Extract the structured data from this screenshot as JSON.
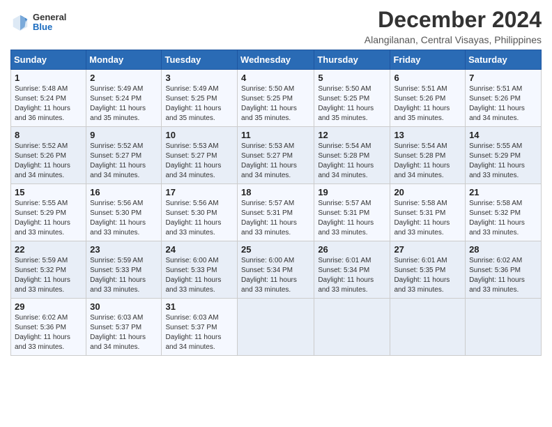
{
  "logo": {
    "general": "General",
    "blue": "Blue"
  },
  "title": "December 2024",
  "subtitle": "Alangilanan, Central Visayas, Philippines",
  "days_of_week": [
    "Sunday",
    "Monday",
    "Tuesday",
    "Wednesday",
    "Thursday",
    "Friday",
    "Saturday"
  ],
  "weeks": [
    [
      {
        "day": "1",
        "sunrise": "5:48 AM",
        "sunset": "5:24 PM",
        "daylight": "11 hours and 36 minutes."
      },
      {
        "day": "2",
        "sunrise": "5:49 AM",
        "sunset": "5:24 PM",
        "daylight": "11 hours and 35 minutes."
      },
      {
        "day": "3",
        "sunrise": "5:49 AM",
        "sunset": "5:25 PM",
        "daylight": "11 hours and 35 minutes."
      },
      {
        "day": "4",
        "sunrise": "5:50 AM",
        "sunset": "5:25 PM",
        "daylight": "11 hours and 35 minutes."
      },
      {
        "day": "5",
        "sunrise": "5:50 AM",
        "sunset": "5:25 PM",
        "daylight": "11 hours and 35 minutes."
      },
      {
        "day": "6",
        "sunrise": "5:51 AM",
        "sunset": "5:26 PM",
        "daylight": "11 hours and 35 minutes."
      },
      {
        "day": "7",
        "sunrise": "5:51 AM",
        "sunset": "5:26 PM",
        "daylight": "11 hours and 34 minutes."
      }
    ],
    [
      {
        "day": "8",
        "sunrise": "5:52 AM",
        "sunset": "5:26 PM",
        "daylight": "11 hours and 34 minutes."
      },
      {
        "day": "9",
        "sunrise": "5:52 AM",
        "sunset": "5:27 PM",
        "daylight": "11 hours and 34 minutes."
      },
      {
        "day": "10",
        "sunrise": "5:53 AM",
        "sunset": "5:27 PM",
        "daylight": "11 hours and 34 minutes."
      },
      {
        "day": "11",
        "sunrise": "5:53 AM",
        "sunset": "5:27 PM",
        "daylight": "11 hours and 34 minutes."
      },
      {
        "day": "12",
        "sunrise": "5:54 AM",
        "sunset": "5:28 PM",
        "daylight": "11 hours and 34 minutes."
      },
      {
        "day": "13",
        "sunrise": "5:54 AM",
        "sunset": "5:28 PM",
        "daylight": "11 hours and 34 minutes."
      },
      {
        "day": "14",
        "sunrise": "5:55 AM",
        "sunset": "5:29 PM",
        "daylight": "11 hours and 33 minutes."
      }
    ],
    [
      {
        "day": "15",
        "sunrise": "5:55 AM",
        "sunset": "5:29 PM",
        "daylight": "11 hours and 33 minutes."
      },
      {
        "day": "16",
        "sunrise": "5:56 AM",
        "sunset": "5:30 PM",
        "daylight": "11 hours and 33 minutes."
      },
      {
        "day": "17",
        "sunrise": "5:56 AM",
        "sunset": "5:30 PM",
        "daylight": "11 hours and 33 minutes."
      },
      {
        "day": "18",
        "sunrise": "5:57 AM",
        "sunset": "5:31 PM",
        "daylight": "11 hours and 33 minutes."
      },
      {
        "day": "19",
        "sunrise": "5:57 AM",
        "sunset": "5:31 PM",
        "daylight": "11 hours and 33 minutes."
      },
      {
        "day": "20",
        "sunrise": "5:58 AM",
        "sunset": "5:31 PM",
        "daylight": "11 hours and 33 minutes."
      },
      {
        "day": "21",
        "sunrise": "5:58 AM",
        "sunset": "5:32 PM",
        "daylight": "11 hours and 33 minutes."
      }
    ],
    [
      {
        "day": "22",
        "sunrise": "5:59 AM",
        "sunset": "5:32 PM",
        "daylight": "11 hours and 33 minutes."
      },
      {
        "day": "23",
        "sunrise": "5:59 AM",
        "sunset": "5:33 PM",
        "daylight": "11 hours and 33 minutes."
      },
      {
        "day": "24",
        "sunrise": "6:00 AM",
        "sunset": "5:33 PM",
        "daylight": "11 hours and 33 minutes."
      },
      {
        "day": "25",
        "sunrise": "6:00 AM",
        "sunset": "5:34 PM",
        "daylight": "11 hours and 33 minutes."
      },
      {
        "day": "26",
        "sunrise": "6:01 AM",
        "sunset": "5:34 PM",
        "daylight": "11 hours and 33 minutes."
      },
      {
        "day": "27",
        "sunrise": "6:01 AM",
        "sunset": "5:35 PM",
        "daylight": "11 hours and 33 minutes."
      },
      {
        "day": "28",
        "sunrise": "6:02 AM",
        "sunset": "5:36 PM",
        "daylight": "11 hours and 33 minutes."
      }
    ],
    [
      {
        "day": "29",
        "sunrise": "6:02 AM",
        "sunset": "5:36 PM",
        "daylight": "11 hours and 33 minutes."
      },
      {
        "day": "30",
        "sunrise": "6:03 AM",
        "sunset": "5:37 PM",
        "daylight": "11 hours and 34 minutes."
      },
      {
        "day": "31",
        "sunrise": "6:03 AM",
        "sunset": "5:37 PM",
        "daylight": "11 hours and 34 minutes."
      },
      null,
      null,
      null,
      null
    ]
  ],
  "labels": {
    "sunrise_prefix": "Sunrise: ",
    "sunset_prefix": "Sunset: ",
    "daylight_prefix": "Daylight: "
  }
}
